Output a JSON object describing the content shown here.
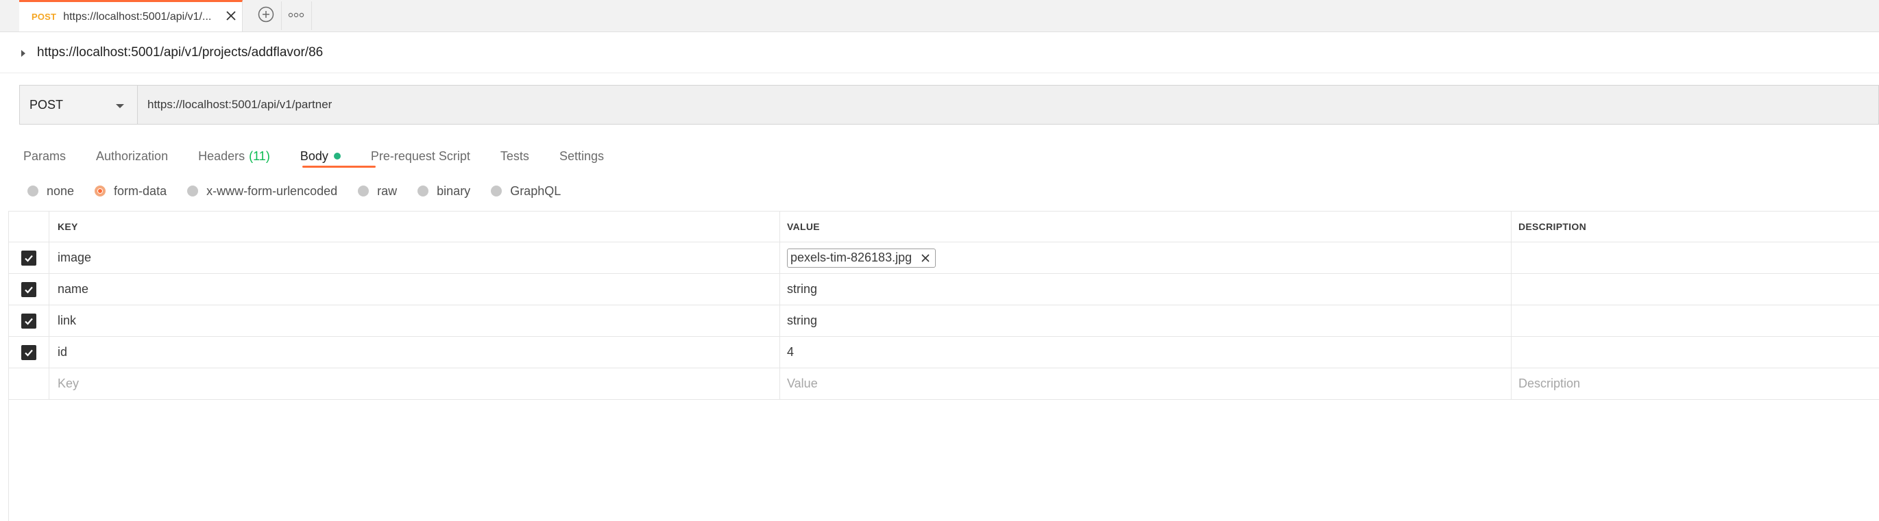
{
  "tabstrip": {
    "active_tab": {
      "method": "POST",
      "title": "https://localhost:5001/api/v1/...",
      "method_color": "#f5a623",
      "accent": "#ff6c37"
    },
    "add_icon": "plus-circle-icon",
    "more_icon": "ellipsis-icon"
  },
  "breadcrumb": {
    "title": "https://localhost:5001/api/v1/projects/addflavor/86"
  },
  "request": {
    "method": "POST",
    "url": "https://localhost:5001/api/v1/partner"
  },
  "request_tabs": [
    {
      "label": "Params"
    },
    {
      "label": "Authorization"
    },
    {
      "label": "Headers",
      "count": "(11)"
    },
    {
      "label": "Body",
      "active": true
    },
    {
      "label": "Pre-request Script"
    },
    {
      "label": "Tests"
    },
    {
      "label": "Settings"
    }
  ],
  "body_types": [
    {
      "label": "none"
    },
    {
      "label": "form-data",
      "selected": true
    },
    {
      "label": "x-www-form-urlencoded"
    },
    {
      "label": "raw"
    },
    {
      "label": "binary"
    },
    {
      "label": "GraphQL"
    }
  ],
  "table": {
    "headers": {
      "key": "KEY",
      "value": "VALUE",
      "description": "DESCRIPTION"
    },
    "rows": [
      {
        "checked": true,
        "key": "image",
        "value": "pexels-tim-826183.jpg",
        "type": "file"
      },
      {
        "checked": true,
        "key": "name",
        "value": "string"
      },
      {
        "checked": true,
        "key": "link",
        "value": "string"
      },
      {
        "checked": true,
        "key": "id",
        "value": "4"
      }
    ],
    "placeholders": {
      "key": "Key",
      "value": "Value",
      "description": "Description"
    }
  }
}
